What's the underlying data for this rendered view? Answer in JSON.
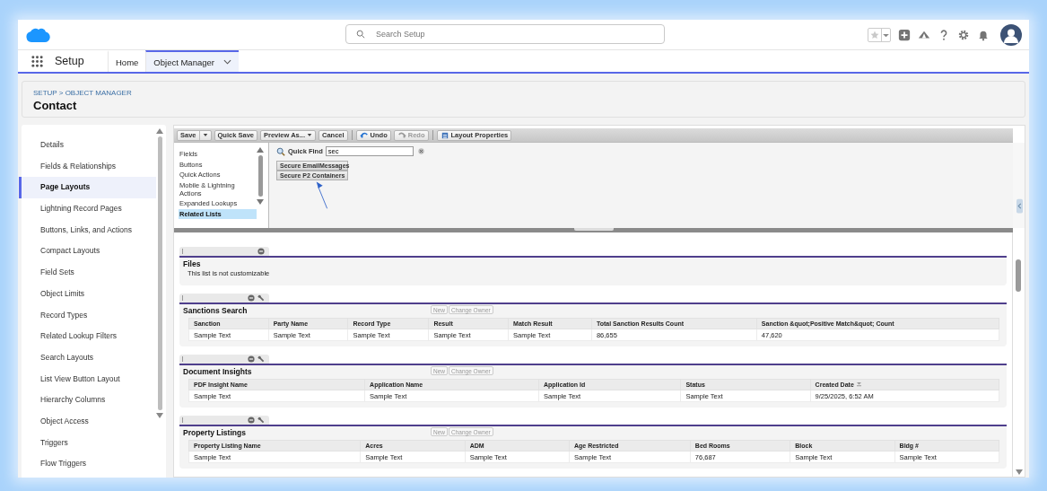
{
  "header": {
    "search": {
      "placeholder": "Search Setup"
    }
  },
  "nav": {
    "app_name": "Setup",
    "tabs": [
      {
        "label": "Home",
        "selected": false
      },
      {
        "label": "Object Manager",
        "selected": true
      }
    ]
  },
  "breadcrumb": "SETUP > OBJECT MANAGER",
  "title": "Contact",
  "sidebar": {
    "items": [
      {
        "label": "Details",
        "selected": false
      },
      {
        "label": "Fields & Relationships",
        "selected": false
      },
      {
        "label": "Page Layouts",
        "selected": true
      },
      {
        "label": "Lightning Record Pages",
        "selected": false
      },
      {
        "label": "Buttons, Links, and Actions",
        "selected": false
      },
      {
        "label": "Compact Layouts",
        "selected": false
      },
      {
        "label": "Field Sets",
        "selected": false
      },
      {
        "label": "Object Limits",
        "selected": false
      },
      {
        "label": "Record Types",
        "selected": false
      },
      {
        "label": "Related Lookup Filters",
        "selected": false
      },
      {
        "label": "Search Layouts",
        "selected": false
      },
      {
        "label": "List View Button Layout",
        "selected": false
      },
      {
        "label": "Hierarchy Columns",
        "selected": false
      },
      {
        "label": "Object Access",
        "selected": false
      },
      {
        "label": "Triggers",
        "selected": false
      },
      {
        "label": "Flow Triggers",
        "selected": false
      }
    ]
  },
  "toolbar": {
    "groups": [
      [
        {
          "label": "Save",
          "kind": "split",
          "disabled": false
        },
        {
          "label": "Quick Save",
          "kind": "plain",
          "disabled": false
        },
        {
          "label": "Preview As...",
          "kind": "menu",
          "disabled": false
        },
        {
          "label": "Cancel",
          "kind": "plain",
          "disabled": false
        }
      ],
      [
        {
          "label": "Undo",
          "kind": "undo",
          "disabled": false
        },
        {
          "label": "Redo",
          "kind": "redo",
          "disabled": true
        }
      ],
      [
        {
          "label": "Layout Properties",
          "kind": "properties",
          "disabled": false
        }
      ]
    ]
  },
  "palette": {
    "categories": [
      {
        "label": "Fields",
        "selected": false
      },
      {
        "label": "Buttons",
        "selected": false
      },
      {
        "label": "Quick Actions",
        "selected": false
      },
      {
        "label": "Mobile & Lightning Actions",
        "selected": false
      },
      {
        "label": "Expanded Lookups",
        "selected": false
      },
      {
        "label": "Related Lists",
        "selected": true
      }
    ],
    "quick_find": {
      "label": "Quick Find",
      "value": "sec"
    },
    "items": [
      "Secure EmailMessages",
      "Secure P2 Containers"
    ]
  },
  "related_lists": [
    {
      "title": "Files",
      "kind": "message",
      "editable": false,
      "message": "This list is not customizable"
    },
    {
      "title": "Sanctions Search",
      "kind": "table",
      "editable": true,
      "buttons": [
        "New",
        "Change Owner"
      ],
      "columns": [
        {
          "label": "Sanction",
          "sorted": false
        },
        {
          "label": "Party Name",
          "sorted": false
        },
        {
          "label": "Record Type",
          "sorted": false
        },
        {
          "label": "Result",
          "sorted": false
        },
        {
          "label": "Match Result",
          "sorted": false
        },
        {
          "label": "Total Sanction Results Count",
          "sorted": false
        },
        {
          "label": "Sanction &quot;Positive Match&quot; Count",
          "sorted": false
        }
      ],
      "rows": [
        [
          "Sample Text",
          "Sample Text",
          "Sample Text",
          "Sample Text",
          "Sample Text",
          "86,655",
          "47,620"
        ]
      ]
    },
    {
      "title": "Document Insights",
      "kind": "table",
      "editable": true,
      "buttons": [
        "New",
        "Change Owner"
      ],
      "columns": [
        {
          "label": "PDF Insight Name",
          "sorted": false
        },
        {
          "label": "Application Name",
          "sorted": false
        },
        {
          "label": "Application Id",
          "sorted": false
        },
        {
          "label": "Status",
          "sorted": false
        },
        {
          "label": "Created Date",
          "sorted": true
        }
      ],
      "rows": [
        [
          "Sample Text",
          "Sample Text",
          "Sample Text",
          "Sample Text",
          "9/25/2025, 6:52 AM"
        ]
      ]
    },
    {
      "title": "Property Listings",
      "kind": "table",
      "editable": true,
      "buttons": [
        "New",
        "Change Owner"
      ],
      "columns": [
        {
          "label": "Property Listing Name",
          "sorted": false
        },
        {
          "label": "Acres",
          "sorted": false
        },
        {
          "label": "ADM",
          "sorted": false
        },
        {
          "label": "Age Restricted",
          "sorted": false
        },
        {
          "label": "Bed Rooms",
          "sorted": false
        },
        {
          "label": "Block",
          "sorted": false
        },
        {
          "label": "Bldg #",
          "sorted": false
        }
      ],
      "rows": [
        [
          "Sample Text",
          "Sample Text",
          "Sample Text",
          "Sample Text",
          "76,687",
          "Sample Text",
          "Sample Text"
        ]
      ]
    }
  ]
}
